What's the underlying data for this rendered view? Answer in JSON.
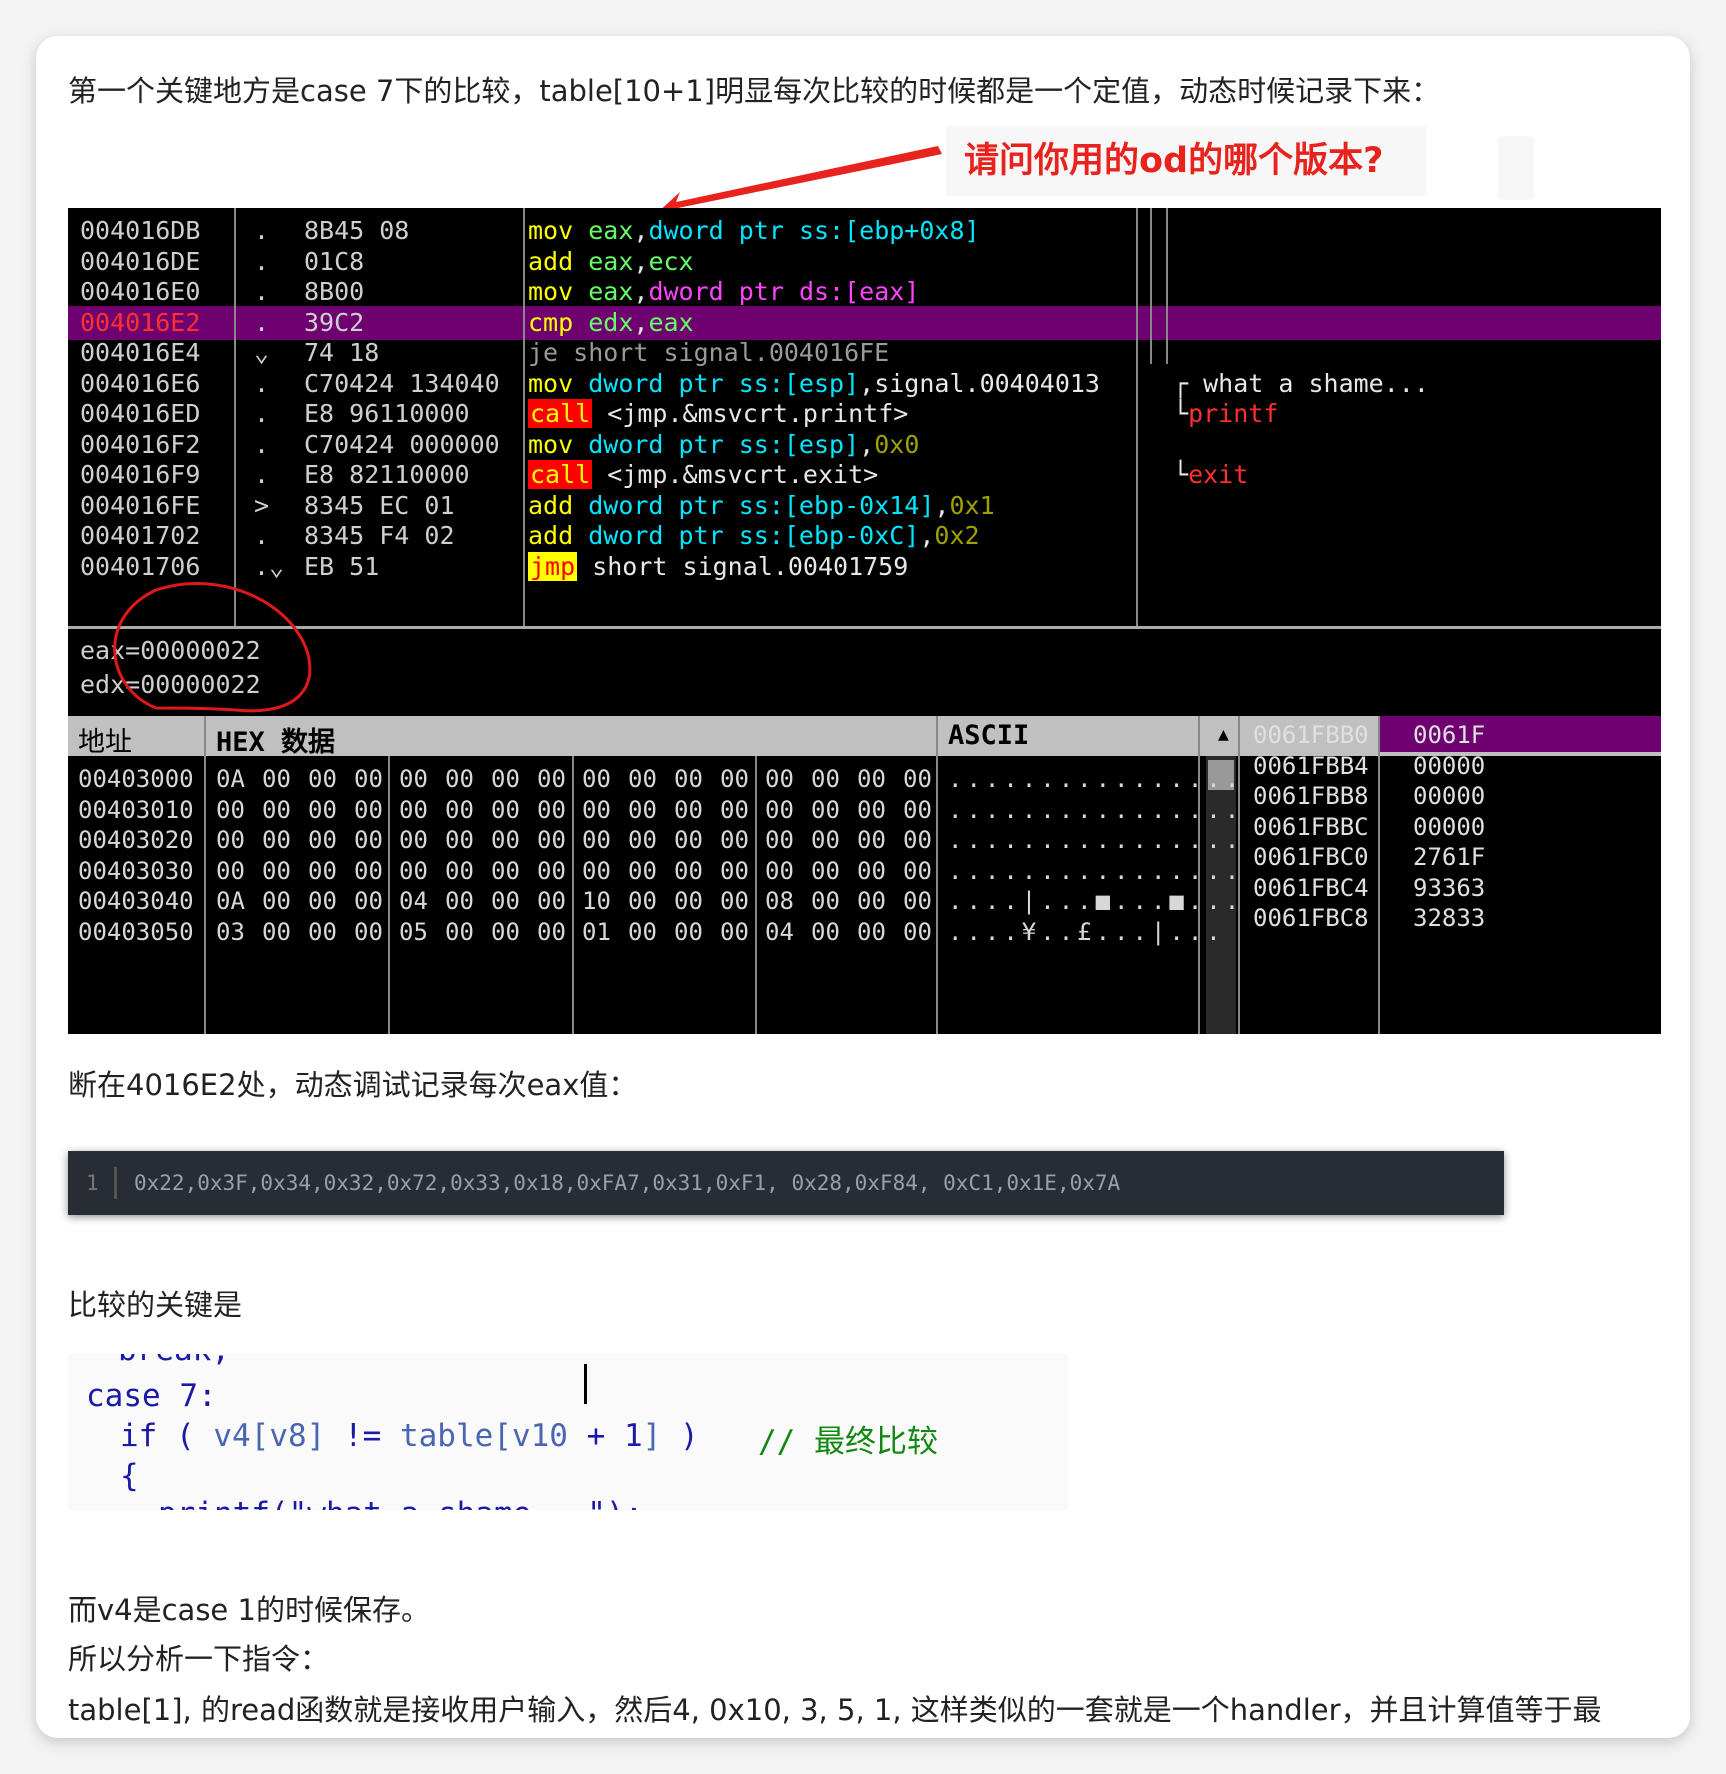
{
  "paragraphs": {
    "p1": "第一个关键地方是case 7下的比较，table[10+1]明显每次比较的时候都是一个定值，动态时候记录下来：",
    "p2": "断在4016E2处，动态调试记录每次eax值：",
    "p3": "比较的关键是",
    "p4": "而v4是case 1的时候保存。",
    "p5": "所以分析一下指令：",
    "p6": "table[1], 的read函数就是接收用户输入，然后4, 0x10, 3, 5, 1, 这样类似的一套就是一个handler，并且计算值等于最"
  },
  "annotation": {
    "question": "请问你用的od的哪个版本?",
    "arrow_color": "#e8231e",
    "circle_color": "#e01818"
  },
  "disasm": [
    {
      "addr": "004016DB",
      "mark": ".",
      "hex": "8B45 08",
      "ins": [
        [
          "mov ",
          "k-ylw"
        ],
        [
          "eax",
          "k-grn"
        ],
        [
          ",",
          "k-white"
        ],
        [
          "dword ptr ss:[ebp+0x8]",
          "k-cyan"
        ]
      ],
      "cmt": []
    },
    {
      "addr": "004016DE",
      "mark": ".",
      "hex": "01C8",
      "ins": [
        [
          "add ",
          "k-ylw"
        ],
        [
          "eax",
          "k-grn"
        ],
        [
          ",",
          "k-white"
        ],
        [
          "ecx",
          "k-grn"
        ]
      ],
      "cmt": []
    },
    {
      "addr": "004016E0",
      "mark": ".",
      "hex": "8B00",
      "ins": [
        [
          "mov ",
          "k-ylw"
        ],
        [
          "eax",
          "k-grn"
        ],
        [
          ",",
          "k-white"
        ],
        [
          "dword ptr ds:[eax]",
          "k-mag"
        ]
      ],
      "cmt": []
    },
    {
      "addr": "004016E2",
      "mark": ".",
      "hex": "39C2",
      "ins": [
        [
          "cmp ",
          "k-ylw"
        ],
        [
          "edx",
          "k-grn"
        ],
        [
          ",",
          "k-white"
        ],
        [
          "eax",
          "k-grn"
        ]
      ],
      "cmt": [],
      "sel": true
    },
    {
      "addr": "004016E4",
      "mark": "⌄",
      "hex": "74 18",
      "ins": [
        [
          "je short signal.004016FE",
          "k-dim"
        ]
      ],
      "cmt": []
    },
    {
      "addr": "004016E6",
      "mark": ".",
      "hex": "C70424 134040",
      "ins": [
        [
          "mov ",
          "k-ylw"
        ],
        [
          "dword ptr ss:[esp]",
          "k-cyan"
        ],
        [
          ",signal.00404013",
          "k-white"
        ]
      ],
      "cmt": [
        [
          "┌ what a shame...",
          "k-white"
        ]
      ]
    },
    {
      "addr": "004016ED",
      "mark": ".",
      "hex": "E8 96110000",
      "ins": [
        [
          "call",
          "k-call"
        ],
        [
          " <jmp.&msvcrt.printf>",
          "k-white"
        ]
      ],
      "cmt": [
        [
          "└",
          "k-white"
        ],
        [
          "printf",
          "k-red"
        ]
      ]
    },
    {
      "addr": "004016F2",
      "mark": ".",
      "hex": "C70424 000000",
      "ins": [
        [
          "mov ",
          "k-ylw"
        ],
        [
          "dword ptr ss:[esp]",
          "k-cyan"
        ],
        [
          ",",
          "k-white"
        ],
        [
          "0x0",
          "k-olive"
        ]
      ],
      "cmt": []
    },
    {
      "addr": "004016F9",
      "mark": ".",
      "hex": "E8 82110000",
      "ins": [
        [
          "call",
          "k-call"
        ],
        [
          " <jmp.&msvcrt.exit>",
          "k-white"
        ]
      ],
      "cmt": [
        [
          "└",
          "k-white"
        ],
        [
          "exit",
          "k-red"
        ]
      ]
    },
    {
      "addr": "004016FE",
      "mark": ">",
      "hex": "8345 EC 01",
      "ins": [
        [
          "add ",
          "k-ylw"
        ],
        [
          "dword ptr ss:[ebp-0x14]",
          "k-cyan"
        ],
        [
          ",",
          "k-white"
        ],
        [
          "0x1",
          "k-olive"
        ]
      ],
      "cmt": []
    },
    {
      "addr": "00401702",
      "mark": ".",
      "hex": "8345 F4 02",
      "ins": [
        [
          "add ",
          "k-ylw"
        ],
        [
          "dword ptr ss:[ebp-0xC]",
          "k-cyan"
        ],
        [
          ",",
          "k-white"
        ],
        [
          "0x2",
          "k-olive"
        ]
      ],
      "cmt": []
    },
    {
      "addr": "00401706",
      "mark": ".⌄",
      "hex": "EB 51",
      "ins": [
        [
          "jmp",
          "k-jmp"
        ],
        [
          " short signal.00401759",
          "k-white"
        ]
      ],
      "cmt": []
    }
  ],
  "registers": [
    "eax=00000022",
    "edx=00000022"
  ],
  "hexdump": {
    "header_addr": "地址",
    "header_hex": "HEX 数据",
    "header_ascii": "ASCII",
    "scroll_glyph": "▲",
    "rows": [
      {
        "addr": "00403000",
        "bytes": [
          "0A",
          "00",
          "00",
          "00",
          "00",
          "00",
          "00",
          "00",
          "00",
          "00",
          "00",
          "00",
          "00",
          "00",
          "00",
          "00"
        ],
        "ascii": "................"
      },
      {
        "addr": "00403010",
        "bytes": [
          "00",
          "00",
          "00",
          "00",
          "00",
          "00",
          "00",
          "00",
          "00",
          "00",
          "00",
          "00",
          "00",
          "00",
          "00",
          "00"
        ],
        "ascii": "................"
      },
      {
        "addr": "00403020",
        "bytes": [
          "00",
          "00",
          "00",
          "00",
          "00",
          "00",
          "00",
          "00",
          "00",
          "00",
          "00",
          "00",
          "00",
          "00",
          "00",
          "00"
        ],
        "ascii": "................"
      },
      {
        "addr": "00403030",
        "bytes": [
          "00",
          "00",
          "00",
          "00",
          "00",
          "00",
          "00",
          "00",
          "00",
          "00",
          "00",
          "00",
          "00",
          "00",
          "00",
          "00"
        ],
        "ascii": "................"
      },
      {
        "addr": "00403040",
        "bytes": [
          "0A",
          "00",
          "00",
          "00",
          "04",
          "00",
          "00",
          "00",
          "10",
          "00",
          "00",
          "00",
          "08",
          "00",
          "00",
          "00"
        ],
        "ascii": "....|...■...■..."
      },
      {
        "addr": "00403050",
        "bytes": [
          "03",
          "00",
          "00",
          "00",
          "05",
          "00",
          "00",
          "00",
          "01",
          "00",
          "00",
          "00",
          "04",
          "00",
          "00",
          "00"
        ],
        "ascii": "....¥..£...|..."
      }
    ]
  },
  "stack": {
    "addrs": [
      "0061FBB0",
      "0061FBB4",
      "0061FBB8",
      "0061FBBC",
      "0061FBC0",
      "0061FBC4",
      "0061FBC8"
    ],
    "vals": [
      "0061F",
      "00000",
      "00000",
      "00000",
      "2761F",
      "93363",
      "32833"
    ]
  },
  "code_block": {
    "line_no": "1",
    "text": "0x22,0x3F,0x34,0x32,0x72,0x33,0x18,0xFA7,0x31,0xF1, 0x28,0xF84, 0xC1,0x1E,0x7A"
  },
  "source": {
    "l0": "break;",
    "case": "case 7:",
    "if_kw": "if",
    "paren_open": " ( ",
    "v4": "v4",
    "idx1": "[v8]",
    "neq": " != ",
    "table": "table",
    "idx2a": "[v10",
    "plus": " + 1",
    "idx2b": "]",
    "paren_close": " )",
    "comment": "// 最终比较",
    "brace": "{",
    "l4": "printf(\"what a shame...\");"
  }
}
